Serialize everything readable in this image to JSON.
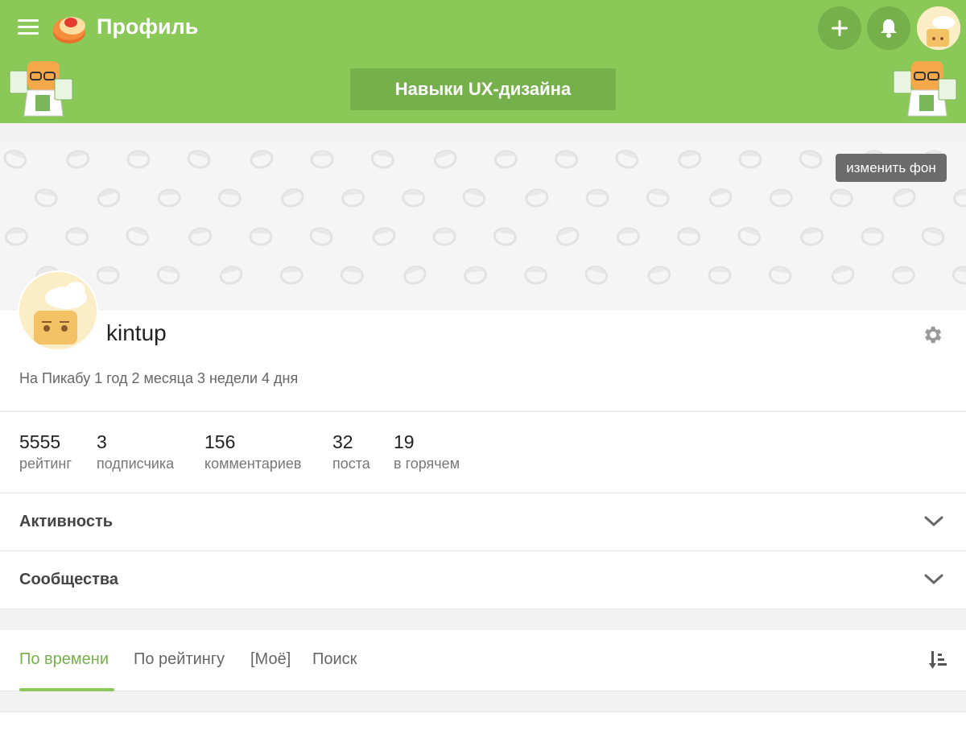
{
  "header": {
    "title": "Профиль",
    "community_button": "Навыки UX-дизайна",
    "accent_color": "#8ac858",
    "dark_accent_color": "#76b04a"
  },
  "background": {
    "change_button": "изменить фон"
  },
  "profile": {
    "username": "kintup",
    "member_since": "На Пикабу 1 год 2 месяца 3 недели 4 дня"
  },
  "stats": [
    {
      "value": "5555",
      "label": "рейтинг"
    },
    {
      "value": "3",
      "label": "подписчика"
    },
    {
      "value": "156",
      "label": "комментариев"
    },
    {
      "value": "32",
      "label": "поста"
    },
    {
      "value": "19",
      "label": "в горячем"
    }
  ],
  "sections": [
    {
      "title": "Активность"
    },
    {
      "title": "Сообщества"
    }
  ],
  "tabs": [
    {
      "label": "По времени",
      "active": true
    },
    {
      "label": "По рейтингу",
      "active": false
    },
    {
      "label": "[Моё]",
      "active": false
    },
    {
      "label": "Поиск",
      "active": false
    }
  ]
}
